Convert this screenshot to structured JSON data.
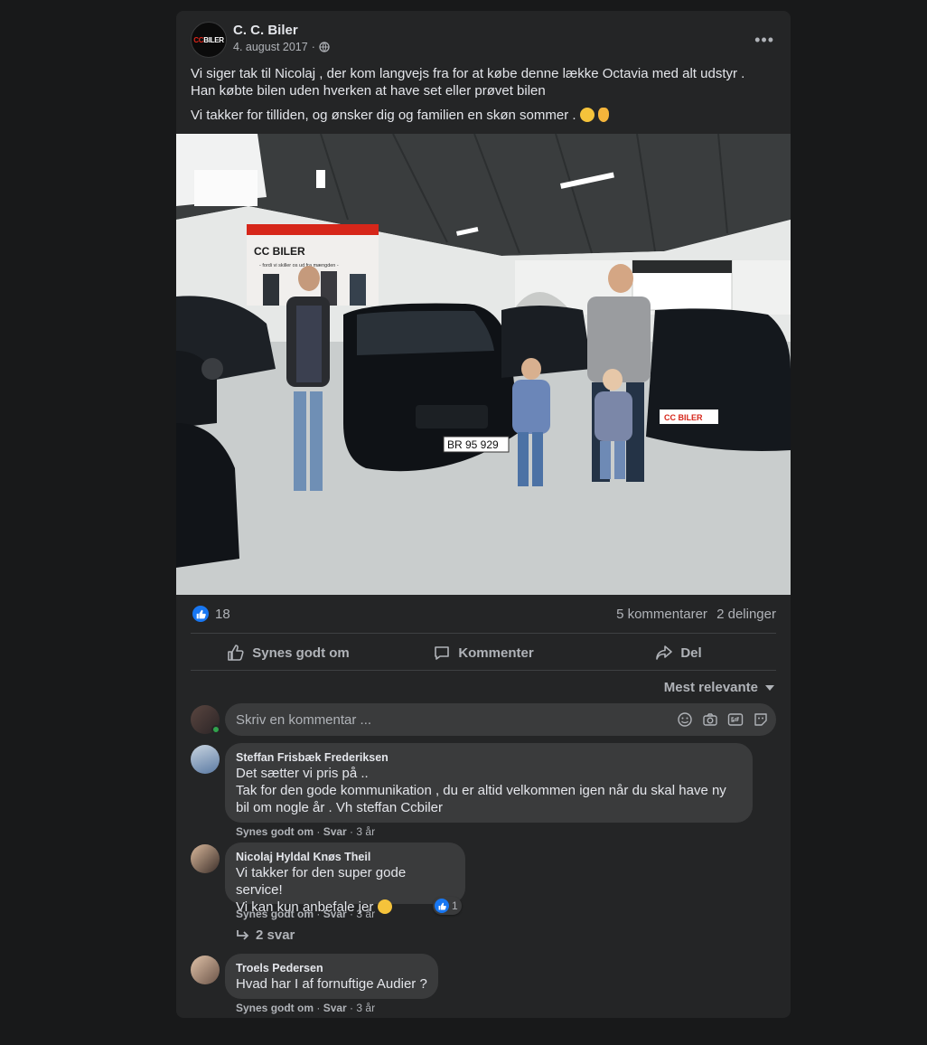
{
  "post": {
    "author": "C. C. Biler",
    "date": "4. august 2017",
    "separator": "·",
    "text_line1": "Vi siger tak til Nicolaj , der kom langvejs fra for at købe denne lække Octavia med alt udstyr .",
    "text_line2": "Han købte bilen uden hverken at have set  eller prøvet bilen",
    "text_line3": "Vi takker for tilliden, og ønsker dig og familien en skøn sommer .",
    "avatar_logo_prefix": "CC",
    "avatar_logo_suffix": "BILER",
    "more_label": "•••"
  },
  "photo": {
    "banner_title": "CC BILER",
    "banner_slogan": "- fordi vi skiller os ud fra mængden -",
    "plate": "BR 95 929",
    "dealer_plate": "CC BILER"
  },
  "stats": {
    "likes": "18",
    "comments": "5 kommentarer",
    "shares": "2 delinger"
  },
  "actions": {
    "like": "Synes godt om",
    "comment": "Kommenter",
    "share": "Del"
  },
  "sort": {
    "label": "Mest relevante"
  },
  "compose": {
    "placeholder": "Skriv en kommentar ..."
  },
  "comments": [
    {
      "author": "Steffan Frisbæk Frederiksen",
      "lines": [
        "Det sætter vi pris på ..",
        "Tak for den gode kommunikation , du er altid velkommen igen når du skal have ny",
        "bil om nogle år . Vh steffan Ccbiler"
      ],
      "like": "Synes godt om",
      "reply": "Svar",
      "time": "3 år"
    },
    {
      "author": "Nicolaj Hyldal Knøs Theil",
      "lines": [
        "Vi takker for den super gode service!",
        "Vi kan kun anbefale jer"
      ],
      "like": "Synes godt om",
      "reply": "Svar",
      "time": "3 år",
      "reactions": "1",
      "replies": "2 svar"
    },
    {
      "author": "Troels Pedersen",
      "lines": [
        "Hvad har I af fornuftige Audier ?"
      ],
      "like": "Synes godt om",
      "reply": "Svar",
      "time": "3 år"
    }
  ],
  "colors": {
    "background": "#18191a",
    "card": "#242526",
    "bubble": "#3a3b3c",
    "text": "#e4e6eb",
    "muted": "#b0b3b8",
    "accent": "#1877f2",
    "brand_red": "#e0261b"
  },
  "icons": {
    "globe": "globe-icon",
    "like": "thumbs-up-icon",
    "comment": "comment-bubble-icon",
    "share": "share-arrow-icon",
    "emoji": "smiley-icon",
    "camera": "camera-icon",
    "gif": "gif-icon",
    "sticker": "sticker-icon",
    "reply_arrow": "reply-arrow-icon"
  }
}
